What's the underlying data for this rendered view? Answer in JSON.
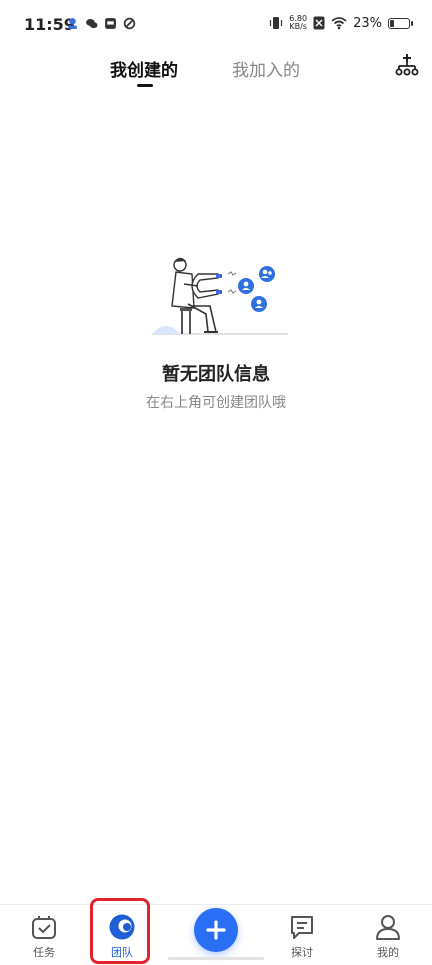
{
  "status_bar": {
    "time": "11:59",
    "net_speed_top": "6.80",
    "net_speed_bottom": "KB/s",
    "battery_percent": "23%",
    "battery_level": 0.23
  },
  "tabs": [
    {
      "label": "我创建的",
      "active": true
    },
    {
      "label": "我加入的",
      "active": false
    }
  ],
  "empty_state": {
    "title": "暂无团队信息",
    "subtitle": "在右上角可创建团队哦"
  },
  "bottom_nav": {
    "items": [
      {
        "label": "任务",
        "icon": "task-icon"
      },
      {
        "label": "团队",
        "icon": "team-icon",
        "active": true
      },
      {
        "label": "探讨",
        "icon": "discuss-icon"
      },
      {
        "label": "我的",
        "icon": "profile-icon"
      }
    ],
    "add_icon": "plus-icon"
  },
  "colors": {
    "accent": "#2a6ef5",
    "active_nav": "#1f5fd6",
    "highlight": "#e0242d"
  }
}
